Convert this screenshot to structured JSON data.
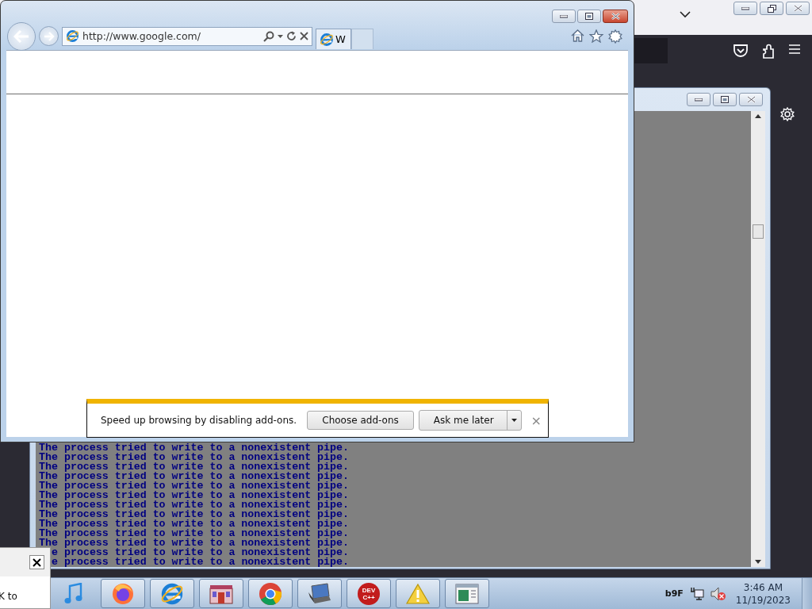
{
  "ie_window": {
    "address": "http://www.google.com/",
    "tabs": [
      {
        "label": "W",
        "selected": true
      }
    ]
  },
  "addon_bar": {
    "message": "Speed up browsing by disabling add-ons.",
    "buttons": [
      {
        "label": "Choose add-ons",
        "kind": "plain"
      },
      {
        "label": "Ask me later",
        "kind": "split"
      }
    ],
    "close": "×"
  },
  "console": {
    "lines": [
      {
        "text": "The process tried to write to a nonexistent pipe.",
        "covered": false
      },
      {
        "text": "The process tried to write to a nonexistent pipe.",
        "covered": false
      },
      {
        "text": "The process tried to write to a nonexistent pipe.",
        "covered": false
      },
      {
        "text": "The process tried to write to a nonexistent pipe.",
        "covered": false
      },
      {
        "text": "The process tried to write to a nonexistent pipe.",
        "covered": false
      },
      {
        "text": "The process tried to write to a nonexistent pipe.",
        "covered": false
      },
      {
        "text": "The process tried to write to a nonexistent pipe.",
        "covered": false
      },
      {
        "text": "The process tried to write to a nonexistent pipe.",
        "covered": false
      },
      {
        "text": "The process tried to write to a nonexistent pipe.",
        "covered": false
      },
      {
        "text": "The process tried to write to a nonexistent pipe.",
        "covered": false
      },
      {
        "text": "The process tried to write to a nonexistent pipe.",
        "covered": false
      },
      {
        "text": "e process tried to write to a nonexistent pipe.",
        "covered": true
      },
      {
        "text": "e process tried to write to a nonexistent pipe.",
        "covered": true
      }
    ]
  },
  "dialog": {
    "text": "K to"
  },
  "taskbar": {
    "buttons": [
      {
        "kind": "music",
        "running": false
      },
      {
        "kind": "firefox",
        "running": true
      },
      {
        "kind": "ie",
        "running": true
      },
      {
        "kind": "building",
        "running": true
      },
      {
        "kind": "chrome",
        "running": true
      },
      {
        "kind": "laptop",
        "running": true
      },
      {
        "kind": "devcpp",
        "label": "DEV C++",
        "running": true
      },
      {
        "kind": "warning",
        "running": true
      },
      {
        "kind": "window",
        "running": true
      }
    ],
    "language": "b9F",
    "time": "3:46 AM",
    "date": "11/19/2023"
  }
}
